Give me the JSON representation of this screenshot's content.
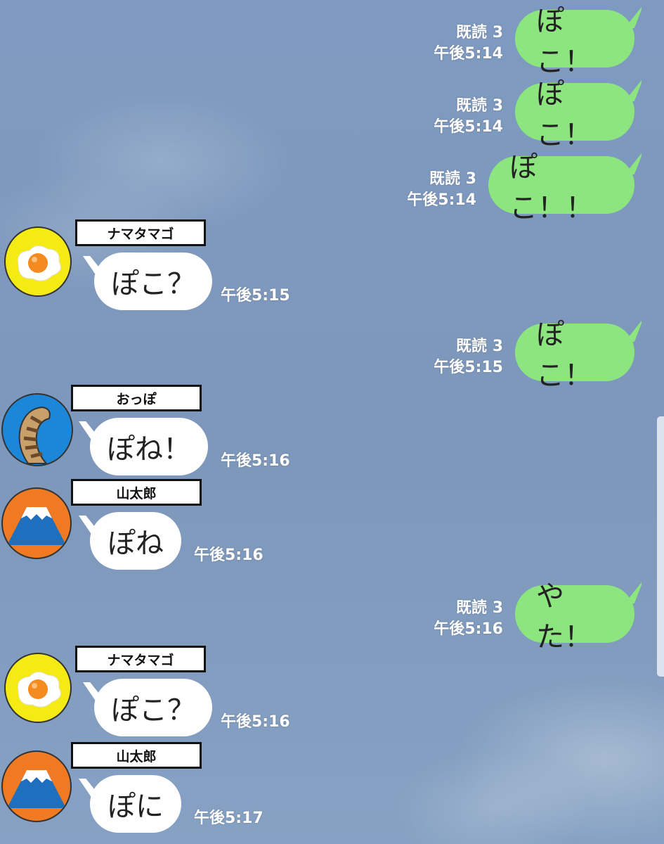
{
  "messages": [
    {
      "side": "out",
      "text": "ぽこ！",
      "read": "既読 3",
      "time": "午後5:14"
    },
    {
      "side": "out",
      "text": "ぽこ！",
      "read": "既読 3",
      "time": "午後5:14"
    },
    {
      "side": "out",
      "text": "ぽこ！！",
      "read": "既読 3",
      "time": "午後5:14"
    },
    {
      "side": "in",
      "sender": "ナマタマゴ",
      "avatar": "egg-icon",
      "text": "ぽこ？",
      "time": "午後5:15"
    },
    {
      "side": "out",
      "text": "ぽこ！",
      "read": "既読 3",
      "time": "午後5:15"
    },
    {
      "side": "in",
      "sender": "おっぽ",
      "avatar": "tail-icon",
      "text": "ぽね！",
      "time": "午後5:16"
    },
    {
      "side": "in",
      "sender": "山太郎",
      "avatar": "mount-fuji-icon",
      "text": "ぽね",
      "time": "午後5:16"
    },
    {
      "side": "out",
      "text": "やた！",
      "read": "既読 3",
      "time": "午後5:16"
    },
    {
      "side": "in",
      "sender": "ナマタマゴ",
      "avatar": "egg-icon",
      "text": "ぽこ？",
      "time": "午後5:16"
    },
    {
      "side": "in",
      "sender": "山太郎",
      "avatar": "mount-fuji-icon",
      "text": "ぽに",
      "time": "午後5:17"
    }
  ],
  "colors": {
    "background": "#7f9bbd",
    "outgoing_bubble": "#8ce57e",
    "incoming_bubble": "#ffffff",
    "egg_avatar_bg": "#f4ea14",
    "fuji_avatar_bg": "#f07a22",
    "tail_avatar_bg": "#1c87d8"
  }
}
